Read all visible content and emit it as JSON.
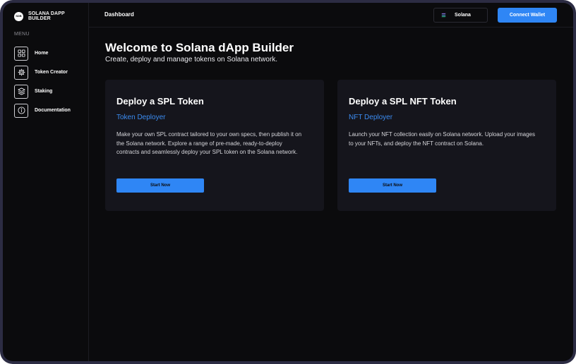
{
  "app": {
    "name": "SOLANA DAPP BUILDER",
    "logo_text": "SDB"
  },
  "sidebar": {
    "menu_label": "MENU",
    "items": [
      {
        "label": "Home",
        "icon": "grid-icon"
      },
      {
        "label": "Token Creator",
        "icon": "gear-icon"
      },
      {
        "label": "Staking",
        "icon": "layers-icon"
      },
      {
        "label": "Documentation",
        "icon": "info-icon"
      }
    ]
  },
  "header": {
    "title": "Dashboard",
    "network": {
      "label": "Solana",
      "icon": "solana-icon"
    },
    "connect_label": "Connect Wallet"
  },
  "hero": {
    "title": "Welcome to Solana dApp Builder",
    "subtitle": "Create, deploy and manage tokens on Solana network."
  },
  "cards": [
    {
      "title": "Deploy a SPL Token",
      "subtitle": "Token Deployer",
      "description": "Make your own SPL contract tailored to your own specs, then publish it on the Solana network. Explore a range of pre-made, ready-to-deploy contracts and seamlessly deploy your SPL token on the Solana network.",
      "button": "Start Now"
    },
    {
      "title": "Deploy a SPL NFT Token",
      "subtitle": "NFT Deployer",
      "description": "Launch your NFT collection easily on Solana network. Upload your images to your NFTs, and deploy the NFT contract on Solana.",
      "button": "Start Now"
    }
  ],
  "colors": {
    "accent": "#2f86f5",
    "link": "#3b8cf2",
    "background": "#0b0b0d",
    "card": "#15151c",
    "frame": "#2c2c43"
  }
}
